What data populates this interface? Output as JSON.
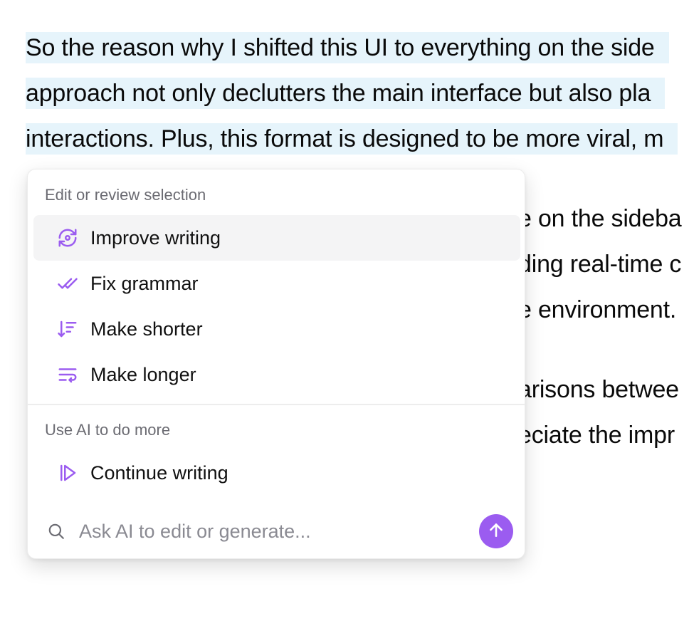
{
  "document": {
    "selected_lines": [
      "So the reason why I shifted this UI to everything on the side",
      "approach not only declutters the main interface but also pla",
      "interactions. Plus, this format is designed to be more viral, m"
    ],
    "visible_fragments": [
      "e on the sideba",
      "ding real-time c",
      "e environment.",
      "arisons betwee",
      "eciate the impr"
    ]
  },
  "menu": {
    "section_edit": "Edit or review selection",
    "items_edit": [
      {
        "label": "Improve writing",
        "icon": "improve-writing-icon"
      },
      {
        "label": "Fix grammar",
        "icon": "double-check-icon"
      },
      {
        "label": "Make shorter",
        "icon": "sort-shorter-icon"
      },
      {
        "label": "Make longer",
        "icon": "wrap-text-icon"
      }
    ],
    "section_ai": "Use AI to do more",
    "items_ai": [
      {
        "label": "Continue writing",
        "icon": "play-forward-icon"
      }
    ],
    "ask": {
      "placeholder": "Ask AI to edit or generate...",
      "value": ""
    }
  },
  "colors": {
    "accent": "#9b5cf0",
    "selection": "#e6f4fb",
    "active_item": "#f4f4f5"
  }
}
